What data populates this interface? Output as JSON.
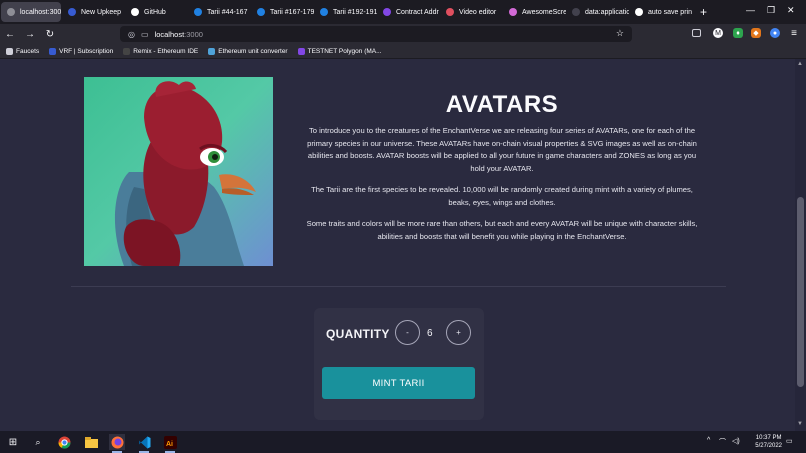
{
  "browser": {
    "tabs": [
      {
        "label": "localhost:3000",
        "active": true,
        "color": "#8e8e96"
      },
      {
        "label": "New Upkeep",
        "color": "#375bd2"
      },
      {
        "label": "GitHub",
        "color": "#ffffff"
      },
      {
        "label": "Tarii #44-167",
        "color": "#2081e2"
      },
      {
        "label": "Tarii #167-179",
        "color": "#2081e2"
      },
      {
        "label": "Tarii #192-191",
        "color": "#2081e2"
      },
      {
        "label": "Contract Addr",
        "color": "#8247e5"
      },
      {
        "label": "Video editor",
        "color": "#e04f5f"
      },
      {
        "label": "AwesomeScre",
        "color": "#d36ad6"
      },
      {
        "label": "data:application/j",
        "color": "#42414d"
      },
      {
        "label": "auto save prin",
        "color": "#ffffff"
      }
    ],
    "new_tab": "+",
    "url_host": "localhost",
    "url_port": ":3000",
    "bookmarks": [
      {
        "label": "Faucets",
        "color": "#cfcfd8"
      },
      {
        "label": "VRF | Subscription",
        "color": "#375bd2"
      },
      {
        "label": "Remix - Ethereum IDE",
        "color": "#444444"
      },
      {
        "label": "Ethereum unit converter",
        "color": "#4fa3d9"
      },
      {
        "label": "TESTNET Polygon (MA...",
        "color": "#8247e5"
      }
    ]
  },
  "page": {
    "title": "AVATARS",
    "paragraphs": [
      "To introduce you to the creatures of the EnchantVerse we are releasing four series of AVATARs, one for each of the primary species in our universe. These AVATARs have on-chain visual properties & SVG images as well as on-chain abilities and boosts. AVATAR boosts will be applied to all your future in game characters and ZONES as long as you hold your AVATAR.",
      "The Tarii are the first species to be revealed. 10,000 will be randomly created during mint with a variety of plumes, beaks, eyes, wings and clothes.",
      "Some traits and colors will be more rare than others, but each and every AVATAR will be unique with character skills, abilities and boosts that will benefit you while playing in the EnchantVerse."
    ],
    "quantity_label": "QUANTITY",
    "decrement": "-",
    "increment": "+",
    "quantity": "6",
    "mint_label": "MINT TARII",
    "accent_color": "#19919c"
  },
  "taskbar": {
    "time": "10:37 PM",
    "date": "5/27/2022"
  }
}
